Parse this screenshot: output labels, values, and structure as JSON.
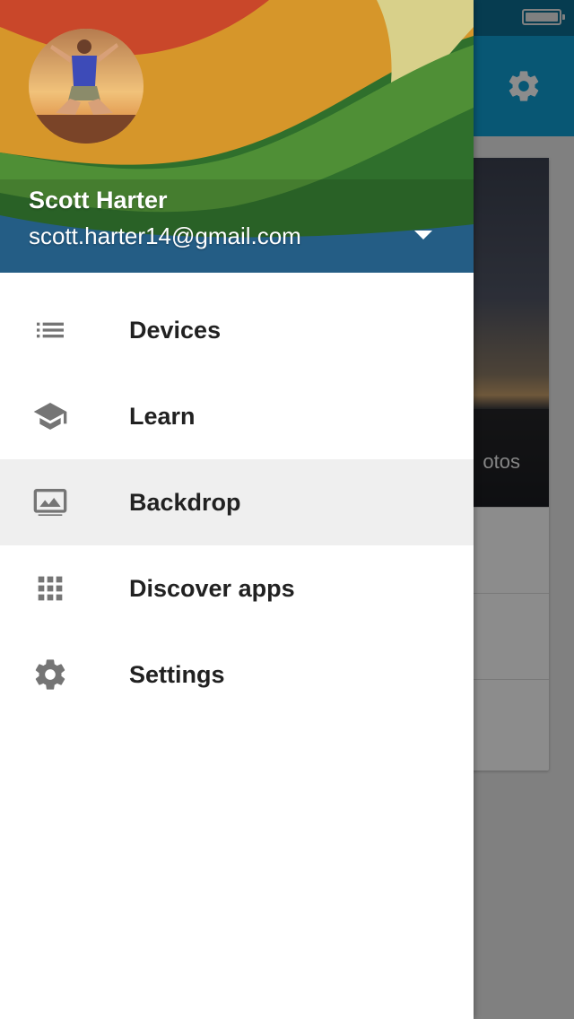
{
  "background_app": {
    "card_caption_partial": "otos"
  },
  "drawer": {
    "user": {
      "name": "Scott Harter",
      "email": "scott.harter14@gmail.com"
    },
    "nav_items": [
      {
        "label": "Devices",
        "icon": "list-icon",
        "selected": false
      },
      {
        "label": "Learn",
        "icon": "school-icon",
        "selected": false
      },
      {
        "label": "Backdrop",
        "icon": "image-icon",
        "selected": true
      },
      {
        "label": "Discover apps",
        "icon": "apps-grid-icon",
        "selected": false
      },
      {
        "label": "Settings",
        "icon": "gear-icon",
        "selected": false
      }
    ]
  },
  "colors": {
    "status_bar": "#0b6e93",
    "app_bar": "#0f9fd4",
    "icon_grey": "#757575",
    "selected_row": "#efefef",
    "text_primary": "#212121"
  }
}
